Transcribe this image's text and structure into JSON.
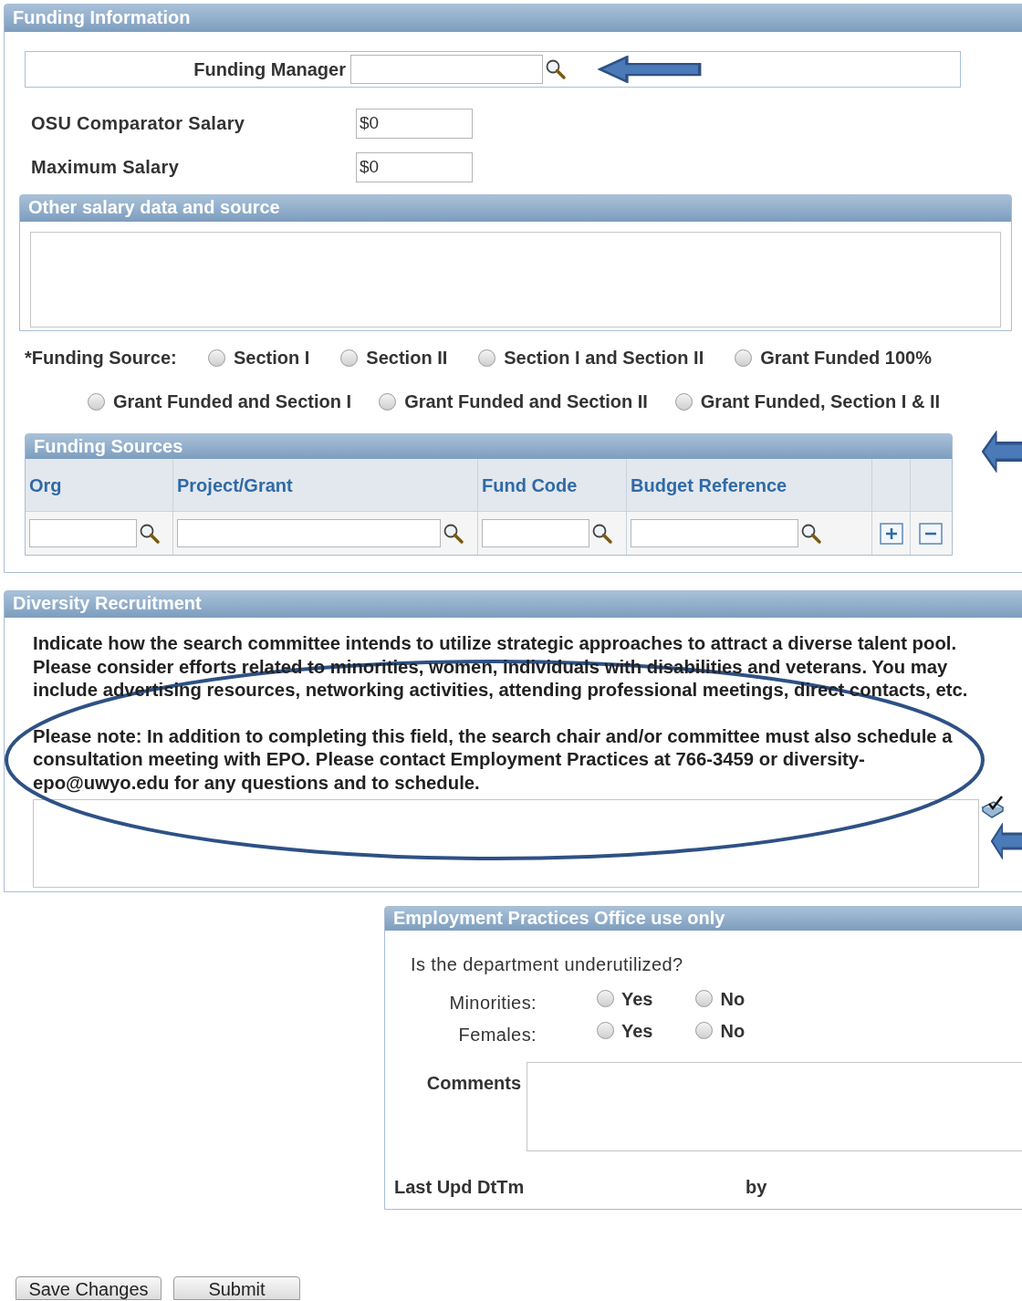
{
  "funding_information": {
    "title": "Funding Information",
    "funding_manager": {
      "label": "Funding Manager"
    },
    "salaries": [
      {
        "label": "OSU Comparator Salary",
        "value": "$0"
      },
      {
        "label": "Maximum Salary",
        "value": "$0"
      }
    ],
    "other_salary": {
      "title": "Other salary data and source"
    },
    "funding_source": {
      "label": "*Funding Source:",
      "options": [
        {
          "label": "Section I",
          "selected": false
        },
        {
          "label": "Section II",
          "selected": false
        },
        {
          "label": "Section I and Section II",
          "selected": false
        },
        {
          "label": "Grant Funded 100%",
          "selected": false
        },
        {
          "label": "Grant Funded and Section I",
          "selected": false
        },
        {
          "label": "Grant Funded and Section II",
          "selected": false
        },
        {
          "label": "Grant Funded, Section I & II",
          "selected": false
        }
      ]
    },
    "funding_sources_grid": {
      "title": "Funding Sources",
      "columns": [
        "Org",
        "Project/Grant",
        "Fund Code",
        "Budget Reference"
      ]
    }
  },
  "diversity_recruitment": {
    "title": "Diversity Recruitment",
    "paragraphs": [
      "Indicate how the search committee intends to utilize strategic approaches to attract a diverse talent pool. Please consider efforts related to minorities, women, individuals with disabilities and veterans. You may include advertising resources, networking activities, attending professional meetings, direct contacts, etc.",
      "Please note: In addition to completing this field, the search chair and/or committee must also schedule a consultation meeting with EPO. Please contact Employment Practices at 766-3459 or diversity-epo@uwyo.edu for any questions and to schedule."
    ]
  },
  "epo": {
    "title": "Employment Practices Office use only",
    "question": "Is the department underutilized?",
    "rows": [
      {
        "label": "Minorities:",
        "options": [
          {
            "label": "Yes",
            "selected": false
          },
          {
            "label": "No",
            "selected": false
          }
        ]
      },
      {
        "label": "Females:",
        "options": [
          {
            "label": "Yes",
            "selected": false
          },
          {
            "label": "No",
            "selected": false
          }
        ]
      }
    ],
    "comments_label": "Comments",
    "last_updated_label": "Last Upd DtTm",
    "by_label": "by"
  },
  "buttons": [
    "Save Changes",
    "Submit"
  ]
}
